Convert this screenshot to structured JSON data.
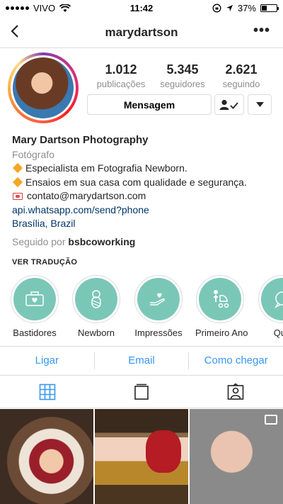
{
  "status_bar": {
    "carrier": "VIVO",
    "time": "11:42",
    "battery": "37%",
    "battery_level": 0.37
  },
  "nav": {
    "username": "marydartson"
  },
  "stats": [
    {
      "value": "1.012",
      "label": "publicações"
    },
    {
      "value": "5.345",
      "label": "seguidores"
    },
    {
      "value": "2.621",
      "label": "seguindo"
    }
  ],
  "buttons": {
    "message": "Mensagem"
  },
  "bio": {
    "name": "Mary Dartson Photography",
    "category": "Fotógrafo",
    "line1": "Especialista em Fotografia Newborn.",
    "line2": "Ensaios em sua casa com qualidade e segurança.",
    "line3": "contato@marydartson.com",
    "link": "api.whatsapp.com/send?phone",
    "location": "Brasília, Brazil",
    "followed_prefix": "Seguido por",
    "followed_by": "bsbcoworking",
    "translate": "VER TRADUÇÃO"
  },
  "highlights": [
    {
      "label": "Bastidores",
      "icon": "camera-heart-icon"
    },
    {
      "label": "Newborn",
      "icon": "swaddled-baby-icon"
    },
    {
      "label": "Impressões",
      "icon": "hand-heart-icon"
    },
    {
      "label": "Primeiro Ano",
      "icon": "baby-stroller-icon"
    },
    {
      "label": "Quo",
      "icon": "chat-heart-icon"
    }
  ],
  "actions": [
    "Ligar",
    "Email",
    "Como chegar"
  ],
  "colors": {
    "accent": "#3897f0",
    "highlight_bg": "#7ac7b8",
    "link": "#003569"
  }
}
